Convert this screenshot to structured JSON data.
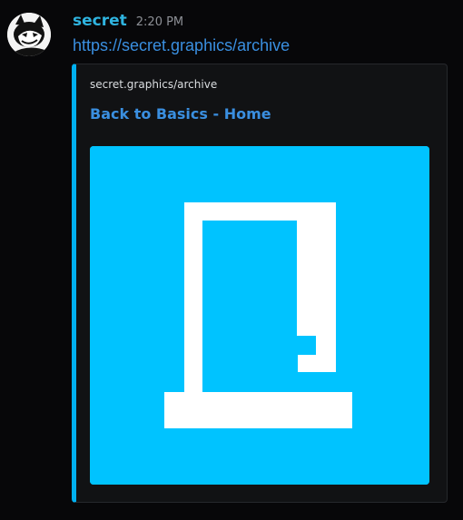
{
  "message": {
    "author": "secret",
    "timestamp": "2:20 PM",
    "link": "https://secret.graphics/archive"
  },
  "embed": {
    "provider": "secret.graphics/archive",
    "title": "Back to Basics - Home",
    "accent_color": "#00b0f0",
    "image_background": "#00c3ff"
  },
  "colors": {
    "author": "#2fb4e0",
    "link": "#3a8fe0",
    "background": "#070709"
  },
  "icons": {
    "avatar": "cartoon-cat-avatar-icon",
    "embed_image": "door-logo-icon"
  }
}
